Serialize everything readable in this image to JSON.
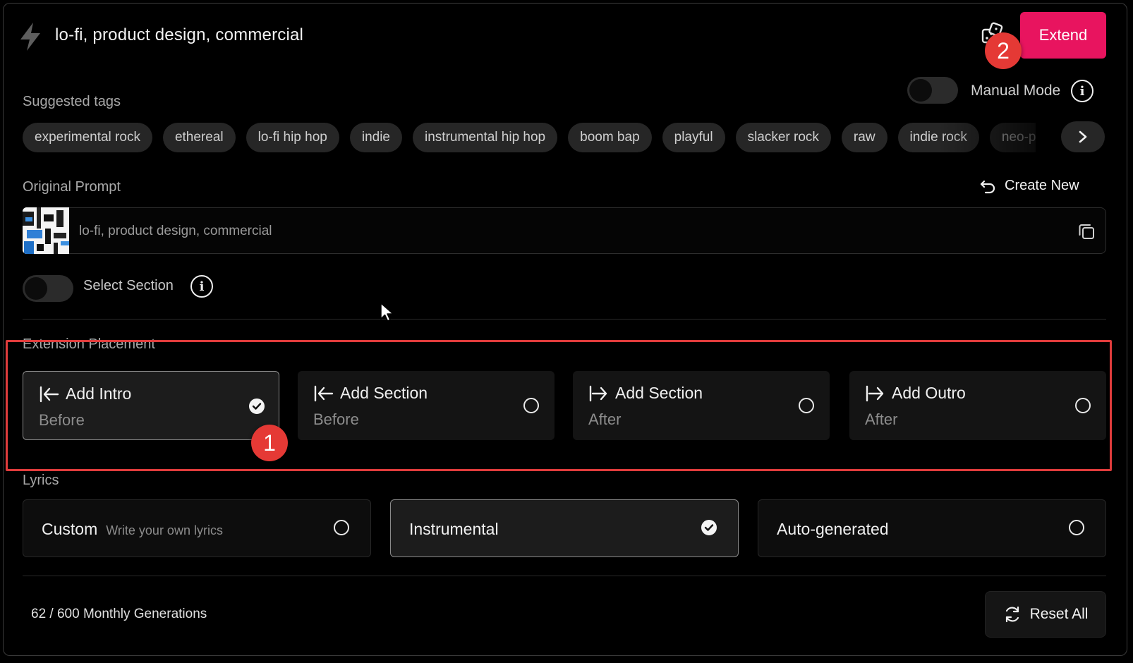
{
  "header": {
    "title": "lo-fi, product design, commercial",
    "extend_label": "Extend",
    "bolt_icon": "bolt-icon",
    "dice_icon": "dice-icon"
  },
  "badges": {
    "badge1": "1",
    "badge2": "2"
  },
  "manual_mode": {
    "label": "Manual Mode",
    "enabled": false
  },
  "suggested_tags": {
    "label": "Suggested tags",
    "items": [
      "experimental rock",
      "ethereal",
      "lo-fi hip hop",
      "indie",
      "instrumental hip hop",
      "boom bap",
      "playful",
      "slacker rock",
      "raw",
      "indie rock",
      "neo-psychedelia"
    ]
  },
  "original_prompt": {
    "label": "Original Prompt",
    "create_new_label": "Create New",
    "text": "lo-fi, product design, commercial"
  },
  "select_section": {
    "label": "Select Section",
    "enabled": false
  },
  "extension_placement": {
    "label": "Extension Placement",
    "options": [
      {
        "title": "Add Intro",
        "sub": "Before",
        "selected": true
      },
      {
        "title": "Add Section",
        "sub": "Before",
        "selected": false
      },
      {
        "title": "Add Section",
        "sub": "After",
        "selected": false
      },
      {
        "title": "Add Outro",
        "sub": "After",
        "selected": false
      }
    ]
  },
  "lyrics": {
    "label": "Lyrics",
    "options": [
      {
        "title": "Custom",
        "hint": "Write your own lyrics",
        "selected": false
      },
      {
        "title": "Instrumental",
        "hint": "",
        "selected": true
      },
      {
        "title": "Auto-generated",
        "hint": "",
        "selected": false
      }
    ]
  },
  "footer": {
    "generations": "62 / 600 Monthly Generations",
    "reset_label": "Reset All"
  },
  "colors": {
    "accent": "#e8145f",
    "highlight": "#e03c3c",
    "badge": "#e53935"
  }
}
